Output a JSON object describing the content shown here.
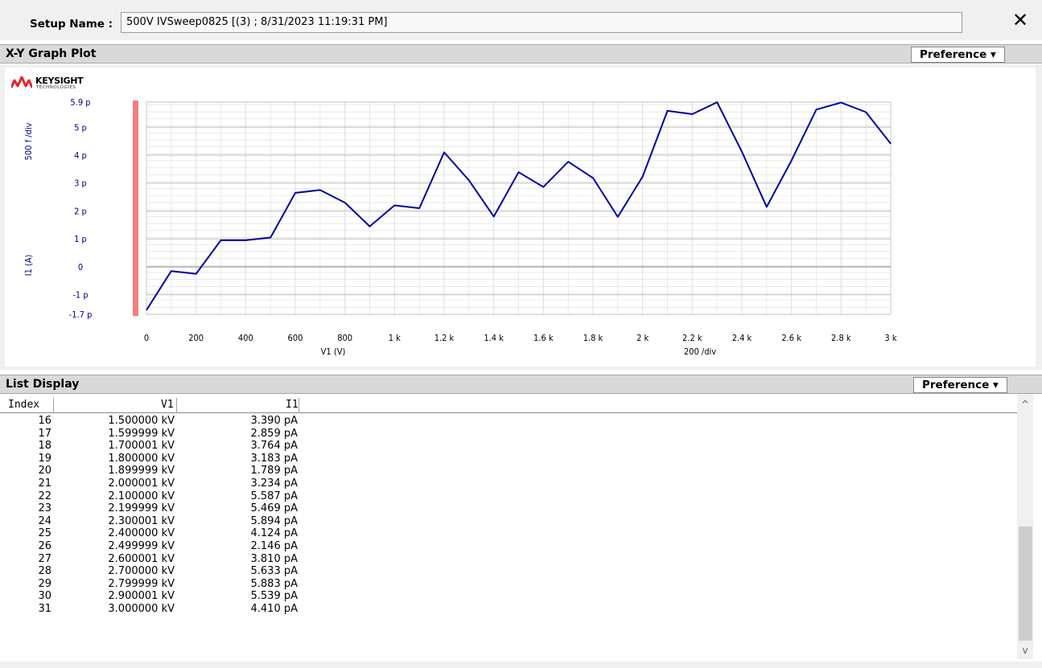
{
  "setup": {
    "label": "Setup Name :",
    "value": "500V IVSweep0825 [(3) ; 8/31/2023 11:19:31 PM]",
    "close_glyph": "✕"
  },
  "graph_panel": {
    "title": "X-Y Graph Plot",
    "preference_label": "Preference ▾",
    "logo": {
      "brand": "KEYSIGHT",
      "sub": "TECHNOLOGIES",
      "icon": "keysight-wave-icon"
    }
  },
  "list_panel": {
    "title": "List Display",
    "preference_label": "Preference ▾",
    "columns": [
      "Index",
      "V1",
      "I1"
    ],
    "rows": [
      [
        "16",
        "1.500000 kV",
        "3.390 pA"
      ],
      [
        "17",
        "1.599999 kV",
        "2.859 pA"
      ],
      [
        "18",
        "1.700001 kV",
        "3.764 pA"
      ],
      [
        "19",
        "1.800000 kV",
        "3.183 pA"
      ],
      [
        "20",
        "1.899999 kV",
        "1.789 pA"
      ],
      [
        "21",
        "2.000001 kV",
        "3.234 pA"
      ],
      [
        "22",
        "2.100000 kV",
        "5.587 pA"
      ],
      [
        "23",
        "2.199999 kV",
        "5.469 pA"
      ],
      [
        "24",
        "2.300001 kV",
        "5.894 pA"
      ],
      [
        "25",
        "2.400000 kV",
        "4.124 pA"
      ],
      [
        "26",
        "2.499999 kV",
        "2.146 pA"
      ],
      [
        "27",
        "2.600001 kV",
        "3.810 pA"
      ],
      [
        "28",
        "2.700000 kV",
        "5.633 pA"
      ],
      [
        "29",
        "2.799999 kV",
        "5.883 pA"
      ],
      [
        "30",
        "2.900001 kV",
        "5.539 pA"
      ],
      [
        "31",
        "3.000000 kV",
        "4.410 pA"
      ]
    ],
    "scroll": {
      "up_glyph": "^",
      "down_glyph": "v"
    }
  },
  "colors": {
    "line": "#0000a0",
    "axis_text": "#00008b",
    "cursor_bar": "#f08080",
    "grid": "#c8c8c8"
  },
  "chart_data": {
    "type": "line",
    "xlabel": "V1 (V)",
    "ylabel": "I1 (A)",
    "x_div_label": "200  /div",
    "y_div_label": "500 f /div",
    "xlim": [
      0,
      3000
    ],
    "ylim": [
      -1.7,
      5.9
    ],
    "x_ticks": [
      0,
      200,
      400,
      600,
      800,
      1000,
      1200,
      1400,
      1600,
      1800,
      2000,
      2200,
      2400,
      2600,
      2800,
      3000
    ],
    "x_tick_labels": [
      "0",
      "200",
      "400",
      "600",
      "800",
      "1 k",
      "1.2 k",
      "1.4 k",
      "1.6 k",
      "1.8 k",
      "2 k",
      "2.2 k",
      "2.4 k",
      "2.6 k",
      "2.8 k",
      "3 k"
    ],
    "y_ticks": [
      5.9,
      5,
      4,
      3,
      2,
      1,
      0,
      -1,
      -1.7
    ],
    "y_tick_labels": [
      "5.9 p",
      "5 p",
      "4 p",
      "3 p",
      "2 p",
      "1 p",
      "0",
      "-1 p",
      "-1.7 p"
    ],
    "grid": true,
    "series": [
      {
        "x": [
          0,
          100,
          200,
          300,
          400,
          500,
          600,
          700,
          800,
          900,
          1000,
          1100,
          1200,
          1300,
          1400,
          1500,
          1600,
          1700,
          1800,
          1900,
          2000,
          2100,
          2200,
          2300,
          2400,
          2500,
          2600,
          2700,
          2800,
          2900,
          3000
        ],
        "y": [
          -1.55,
          -0.15,
          -0.25,
          0.95,
          0.95,
          1.05,
          2.65,
          2.75,
          2.3,
          1.45,
          2.2,
          2.1,
          4.1,
          3.1,
          1.8,
          3.39,
          2.859,
          3.764,
          3.183,
          1.789,
          3.234,
          5.587,
          5.469,
          5.894,
          4.124,
          2.146,
          3.81,
          5.633,
          5.883,
          5.539,
          4.41
        ]
      }
    ]
  }
}
